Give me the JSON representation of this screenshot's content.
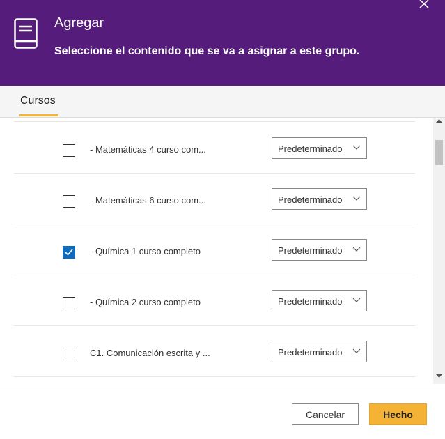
{
  "header": {
    "title": "Agregar",
    "subtitle": "Seleccione el contenido que se va a asignar a este grupo."
  },
  "tabs": [
    {
      "label": "Cursos",
      "active": true
    }
  ],
  "rows": [
    {
      "label": "- Matemáticas 4 curso com...",
      "checked": false,
      "option": "Predeterminado"
    },
    {
      "label": "- Matemáticas 6 curso com...",
      "checked": false,
      "option": "Predeterminado"
    },
    {
      "label": "- Química 1 curso completo",
      "checked": true,
      "option": "Predeterminado"
    },
    {
      "label": "- Química 2 curso completo",
      "checked": false,
      "option": "Predeterminado"
    },
    {
      "label": "C1. Comunicación escrita y ...",
      "checked": false,
      "option": "Predeterminado"
    }
  ],
  "footer": {
    "cancel_label": "Cancelar",
    "done_label": "Hecho"
  },
  "colors": {
    "header_bg": "#561c7c",
    "accent": "#f1b33c",
    "checkbox_checked": "#0f6cbd"
  }
}
